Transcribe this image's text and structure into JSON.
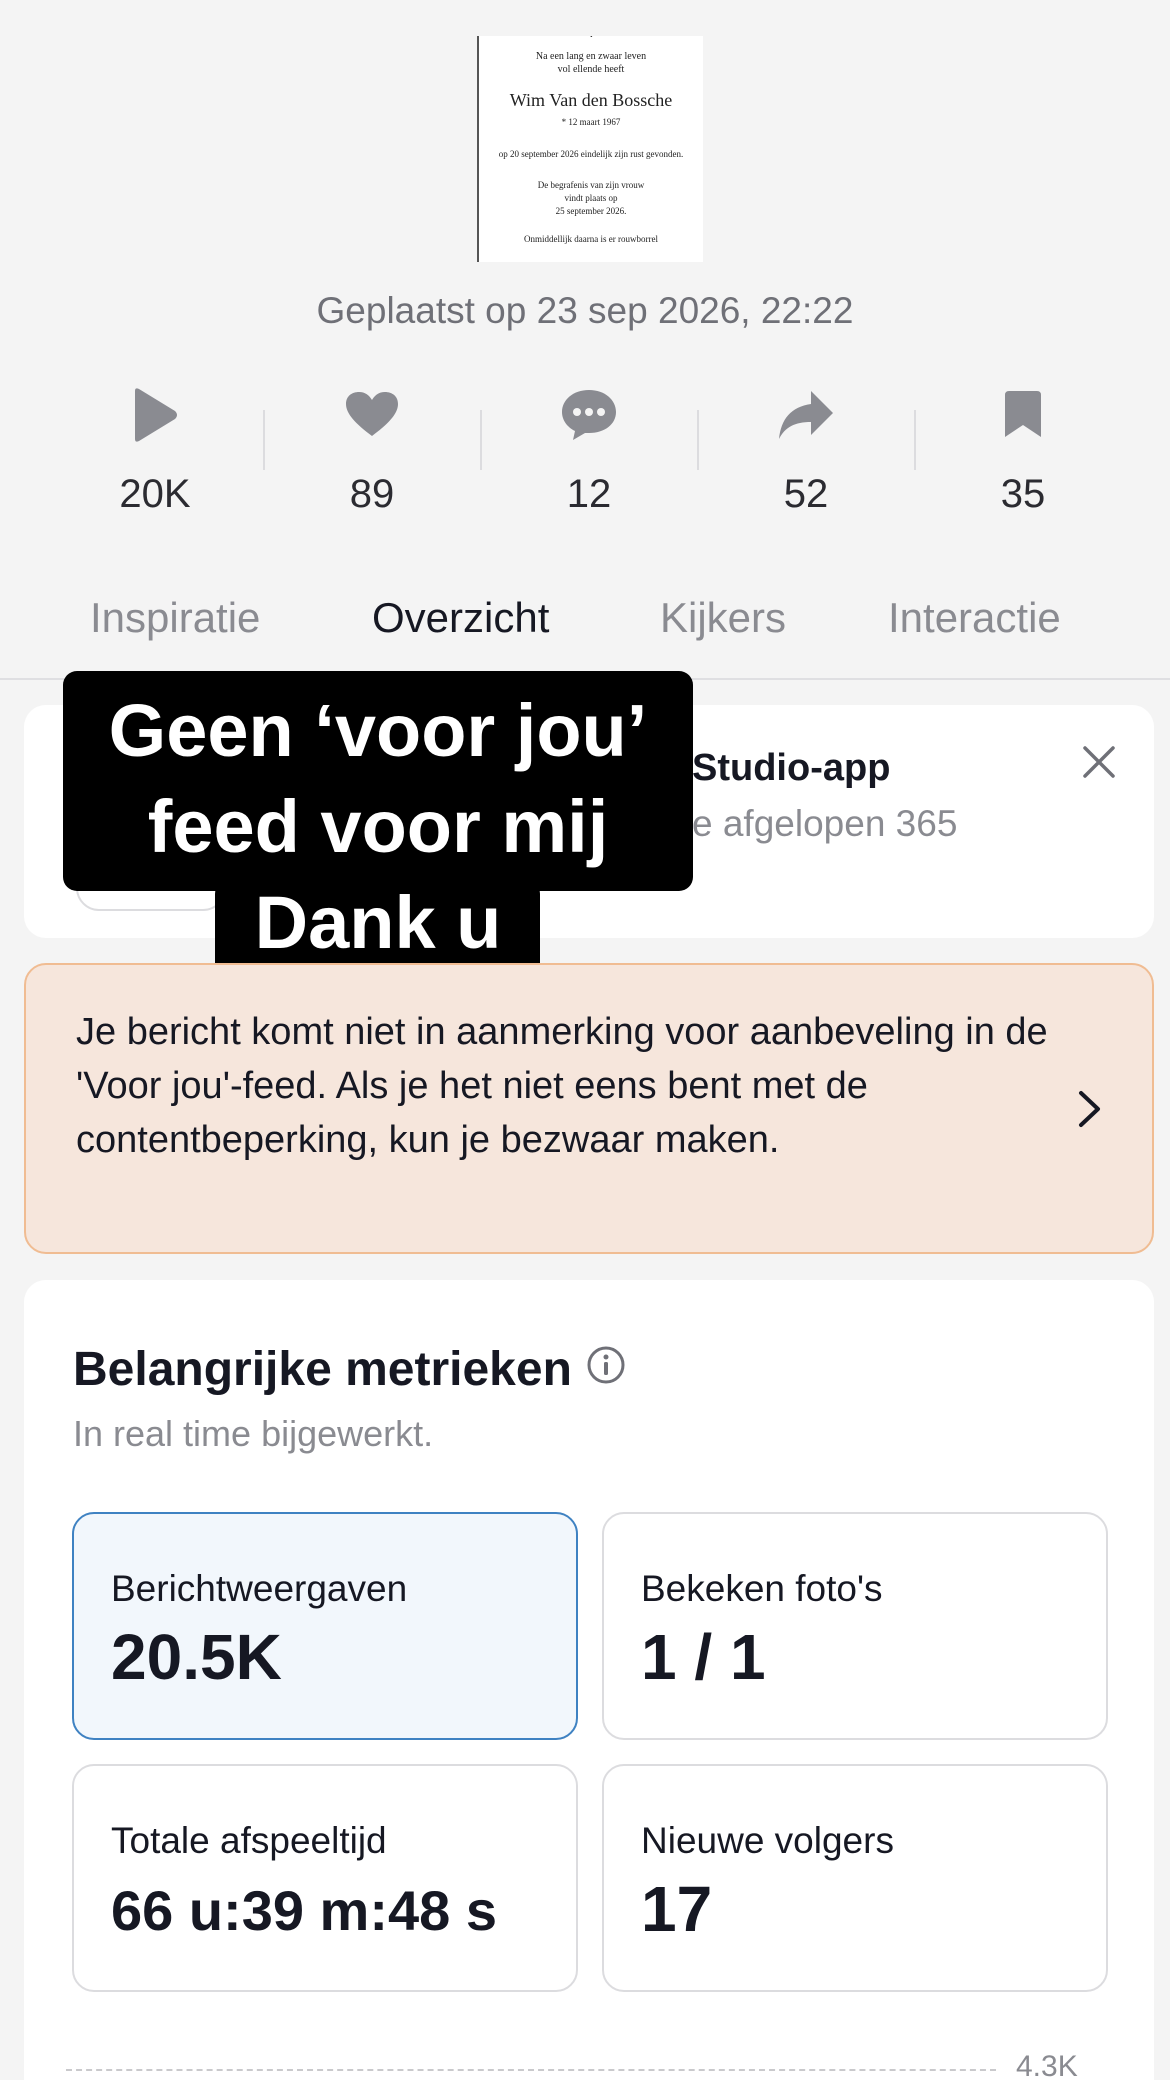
{
  "thumbnail": {
    "line1": "Na een lang en zwaar leven",
    "line2": "vol ellende heeft",
    "name": "Wim Van den Bossche",
    "birth": "* 12 maart 1967",
    "rest": "op 20 september 2026 eindelijk zijn rust gevonden.",
    "funeral1": "De begrafenis van zijn vrouw",
    "funeral2": "vindt plaats op",
    "funeral3": "25 september 2026.",
    "last": "Onmiddellijk daarna is er rouwborrel"
  },
  "posted": "Geplaatst op 23 sep 2026, 22:22",
  "stats": [
    {
      "icon": "play-icon",
      "value": "20K"
    },
    {
      "icon": "heart-icon",
      "value": "89"
    },
    {
      "icon": "comment-icon",
      "value": "12"
    },
    {
      "icon": "share-icon",
      "value": "52"
    },
    {
      "icon": "bookmark-icon",
      "value": "35"
    }
  ],
  "tabs": [
    {
      "label": "Inspiratie",
      "active": false
    },
    {
      "label": "Overzicht",
      "active": true
    },
    {
      "label": "Kijkers",
      "active": false
    },
    {
      "label": "Interactie",
      "active": false
    }
  ],
  "promo": {
    "title": "Studio-app",
    "subtitle": "e afgelopen 365"
  },
  "overlay": {
    "line1": "Geen ‘voor jou’",
    "line2": "feed voor mij",
    "line3": "Dank u"
  },
  "warning": {
    "text": "Je bericht komt niet in aanmerking voor aanbeveling in de 'Voor jou'-feed. Als je het niet eens bent met de contentbeperking, kun je bezwaar maken."
  },
  "metrics": {
    "title": "Belangrijke metrieken",
    "subtitle": "In real time bijgewerkt.",
    "items": [
      {
        "label": "Berichtweergaven",
        "value": "20.5K",
        "selected": true
      },
      {
        "label": "Bekeken foto's",
        "value": "1 / 1",
        "selected": false
      },
      {
        "label": "Totale afspeeltijd",
        "value": "66 u:39 m:48 s",
        "selected": false
      },
      {
        "label": "Nieuwe volgers",
        "value": "17",
        "selected": false
      }
    ],
    "chart_axis_label": "4.3K"
  },
  "colors": {
    "accent_blue": "#3f82c2",
    "warning_bg": "#f6e6dc",
    "warning_border": "#f0bc92",
    "icon_gray": "#8a8b91"
  }
}
